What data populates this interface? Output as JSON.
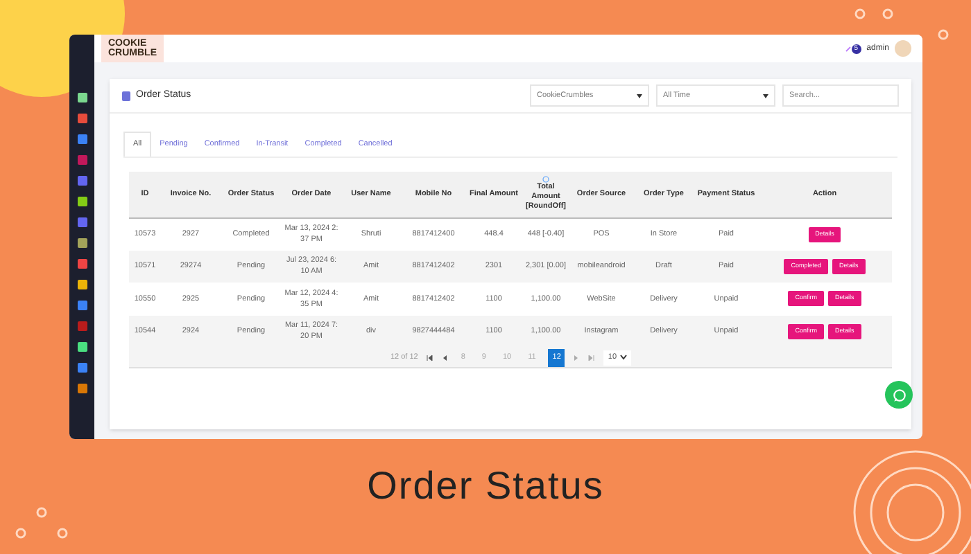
{
  "header": {
    "logo": {
      "line_1": "COOKIE",
      "line_2": "CRUMBLE"
    },
    "notification_count": "5",
    "user": "admin"
  },
  "page": {
    "title": "Order Status",
    "filters": [
      {
        "value": "CookieCrumbles"
      },
      {
        "value": "All Time"
      }
    ],
    "search": {
      "placeholder": "Search..."
    }
  },
  "tabs": [
    {
      "label": "All",
      "selected": true
    },
    {
      "label": "Pending",
      "selected": false
    },
    {
      "label": "Confirmed",
      "selected": false
    },
    {
      "label": "In-Transit",
      "selected": false
    },
    {
      "label": "Completed",
      "selected": false
    },
    {
      "label": "Cancelled",
      "selected": false
    }
  ],
  "table": {
    "columns": [
      "ID",
      "Invoice No.",
      "Order Status",
      "Order Date",
      "User Name",
      "Mobile No",
      "Final Amount",
      "Total Amount [RoundOff]",
      "Order Source",
      "Order Type",
      "Payment Status",
      "Action"
    ],
    "rows": [
      {
        "cells": [
          "10573",
          "2927",
          "Completed",
          "Mar 13, 2024 2:37 PM",
          "Shruti",
          "8817412400",
          "448.4",
          "448 [-0.40]",
          "POS",
          "In Store",
          "Paid"
        ],
        "actions": [
          "Details"
        ]
      },
      {
        "cells": [
          "10571",
          "29274",
          "Pending",
          "Jul 23, 2024 6:10 AM",
          "Amit",
          "8817412402",
          "2301",
          "2,301 [0.00]",
          "mobileandroid",
          "Draft",
          "Paid"
        ],
        "actions": [
          "Completed",
          "Details"
        ]
      },
      {
        "cells": [
          "10550",
          "2925",
          "Pending",
          "Mar 12, 2024 4:35 PM",
          "Amit",
          "8817412402",
          "1100",
          "1,100.00",
          "WebSite",
          "Delivery",
          "Unpaid"
        ],
        "actions": [
          "Confirm",
          "Details"
        ]
      },
      {
        "cells": [
          "10544",
          "2924",
          "Pending",
          "Mar 11, 2024 7:20 PM",
          "div",
          "9827444484",
          "1100",
          "1,100.00",
          "Instagram",
          "Delivery",
          "Unpaid"
        ],
        "actions": [
          "Confirm",
          "Details"
        ]
      }
    ]
  },
  "pagination": {
    "summary": "12 of 12",
    "pages": [
      {
        "label": "8",
        "selected": false
      },
      {
        "label": "9",
        "selected": false
      },
      {
        "label": "10",
        "selected": false
      },
      {
        "label": "11",
        "selected": false
      },
      {
        "label": "12",
        "selected": true
      }
    ],
    "page_size": "10"
  },
  "caption": "Order Status"
}
